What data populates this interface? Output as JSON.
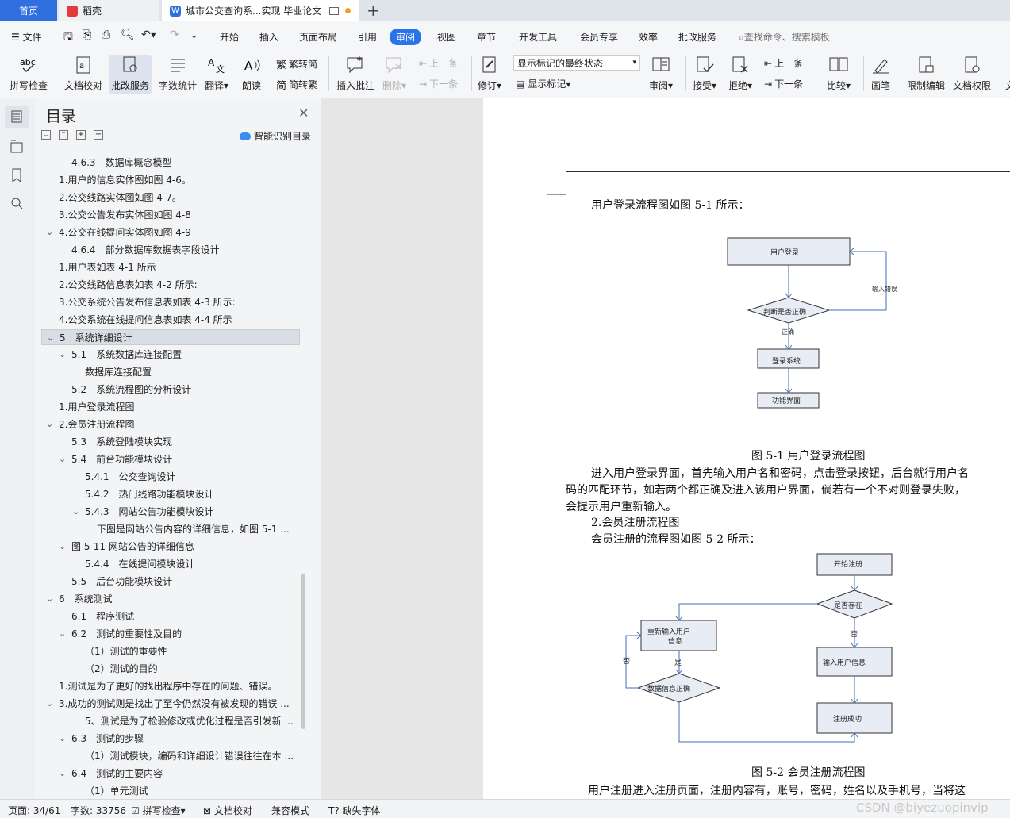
{
  "tabs": {
    "home": "首页",
    "docer": "稻壳",
    "document": "城市公交查询系...实现 毕业论文",
    "new_tab": "+"
  },
  "menu": {
    "file": "文件",
    "items": [
      "开始",
      "插入",
      "页面布局",
      "引用",
      "审阅",
      "视图",
      "章节",
      "开发工具",
      "会员专享",
      "效率",
      "批改服务"
    ],
    "active": "审阅",
    "search_placeholder": "查找命令、搜索模板"
  },
  "ribbon": {
    "spell": "拼写检查",
    "doc_proof": "文档校对",
    "correct_service": "批改服务",
    "word_count": "字数统计",
    "translate": "翻译",
    "read_aloud": "朗读",
    "trad_to_simp": "繁转简",
    "simp_to_trad": "简转繁",
    "insert_comment": "插入批注",
    "delete": "删除",
    "prev_comment": "上一条",
    "next_comment": "下一条",
    "track": "修订",
    "markup_state": "显示标记的最终状态",
    "show_markup": "显示标记",
    "review": "审阅",
    "accept": "接受",
    "reject": "拒绝",
    "prev_change": "上一条",
    "next_change": "下一条",
    "compare": "比较",
    "pen": "画笔",
    "restrict_edit": "限制编辑",
    "doc_permission": "文档权限",
    "more": "文"
  },
  "toc": {
    "title": "目录",
    "smart_recognize": "智能识别目录",
    "items": [
      {
        "text": "4.6.3　数据库概念模型",
        "indent": 2,
        "arrow": ""
      },
      {
        "text": "1.用户的信息实体图如图 4-6。",
        "indent": 1,
        "arrow": ""
      },
      {
        "text": "2.公交线路实体图如图 4-7。",
        "indent": 1,
        "arrow": ""
      },
      {
        "text": "3.公交公告发布实体图如图 4-8",
        "indent": 1,
        "arrow": ""
      },
      {
        "text": "4.公交在线提问实体图如图 4-9",
        "indent": 1,
        "arrow": "v"
      },
      {
        "text": "4.6.4　部分数据库数据表字段设计",
        "indent": 2,
        "arrow": ""
      },
      {
        "text": "1.用户表如表 4-1 所示",
        "indent": 1,
        "arrow": ""
      },
      {
        "text": "2.公交线路信息表如表 4-2 所示:",
        "indent": 1,
        "arrow": ""
      },
      {
        "text": "3.公交系统公告发布信息表如表 4-3 所示:",
        "indent": 1,
        "arrow": ""
      },
      {
        "text": "4.公交系统在线提问信息表如表 4-4 所示",
        "indent": 1,
        "arrow": ""
      },
      {
        "text": "5　系统详细设计",
        "indent": 1,
        "arrow": "v",
        "selected": true
      },
      {
        "text": "5.1　系统数据库连接配置",
        "indent": 2,
        "arrow": "v"
      },
      {
        "text": "数据库连接配置",
        "indent": 3,
        "arrow": ""
      },
      {
        "text": "5.2　系统流程图的分析设计",
        "indent": 2,
        "arrow": ""
      },
      {
        "text": "1.用户登录流程图",
        "indent": 1,
        "arrow": ""
      },
      {
        "text": "2.会员注册流程图",
        "indent": 1,
        "arrow": "v"
      },
      {
        "text": "5.3　系统登陆模块实现",
        "indent": 2,
        "arrow": ""
      },
      {
        "text": "5.4　前台功能模块设计",
        "indent": 2,
        "arrow": "v"
      },
      {
        "text": "5.4.1　公交查询设计",
        "indent": 3,
        "arrow": ""
      },
      {
        "text": "5.4.2　热门线路功能模块设计",
        "indent": 3,
        "arrow": ""
      },
      {
        "text": "5.4.3　网站公告功能模块设计",
        "indent": 3,
        "arrow": "v"
      },
      {
        "text": "下图是网站公告内容的详细信息，如图 5-1 ...",
        "indent": 4,
        "arrow": ""
      },
      {
        "text": "图 5-11 网站公告的详细信息",
        "indent": 2,
        "arrow": "v"
      },
      {
        "text": "5.4.4　在线提问模块设计",
        "indent": 3,
        "arrow": ""
      },
      {
        "text": "5.5　后台功能模块设计",
        "indent": 2,
        "arrow": ""
      },
      {
        "text": "6　系统测试",
        "indent": 1,
        "arrow": "v"
      },
      {
        "text": "6.1　程序测试",
        "indent": 2,
        "arrow": ""
      },
      {
        "text": "6.2　测试的重要性及目的",
        "indent": 2,
        "arrow": "v"
      },
      {
        "text": "（1）测试的重要性",
        "indent": 3,
        "arrow": ""
      },
      {
        "text": "（2）测试的目的",
        "indent": 3,
        "arrow": ""
      },
      {
        "text": "1.测试是为了更好的找出程序中存在的问题、错误。",
        "indent": 1,
        "arrow": ""
      },
      {
        "text": "3.成功的测试则是找出了至今仍然没有被发现的错误 ...",
        "indent": 1,
        "arrow": "v"
      },
      {
        "text": "5、测试是为了检验修改或优化过程是否引发新 ...",
        "indent": 3,
        "arrow": ""
      },
      {
        "text": "6.3　测试的步骤",
        "indent": 2,
        "arrow": "v"
      },
      {
        "text": "（1）测试模块，编码和详细设计错误往往在本 ...",
        "indent": 3,
        "arrow": ""
      },
      {
        "text": "6.4　测试的主要内容",
        "indent": 2,
        "arrow": "v"
      },
      {
        "text": "（1）单元测试",
        "indent": 3,
        "arrow": ""
      }
    ]
  },
  "document": {
    "p1": "用户登录流程图如图 5-1 所示：",
    "fig1": {
      "login": "用户登录",
      "judge": "判断是否正确",
      "input_error": "输入错误",
      "correct": "正确",
      "login_system": "登录系统",
      "function_ui": "功能界面"
    },
    "cap1": "图 5-1 用户登录流程图",
    "para_a": "进入用户登录界面，首先输入用户名和密码，点击登录按钮，后台就行用户名",
    "para_b": "码的匹配环节，如若两个都正确及进入该用户界面，倘若有一个不对则登录失败，",
    "para_c": "会提示用户重新输入。",
    "h2": "2.会员注册流程图",
    "p2": "会员注册的流程图如图 5-2 所示：",
    "fig2": {
      "start": "开始注册",
      "exists": "是否存在",
      "reinput_1": "重新输入用户",
      "reinput_2": "信息",
      "no1": "否",
      "yes": "是",
      "no2": "否",
      "input_user": "输入用户信息",
      "data_ok": "数据信息正确",
      "success": "注册成功"
    },
    "cap2": "图 5-2 会员注册流程图",
    "para_d": "用户注册进入注册页面，注册内容有，账号，密码，姓名以及手机号，当将这"
  },
  "status": {
    "page": "页面: 34/61",
    "words": "字数: 33756",
    "spell": "拼写检查",
    "proof": "文档校对",
    "compat": "兼容模式",
    "missing_font": "缺失字体"
  },
  "watermark": "CSDN @biyezuopinvip"
}
